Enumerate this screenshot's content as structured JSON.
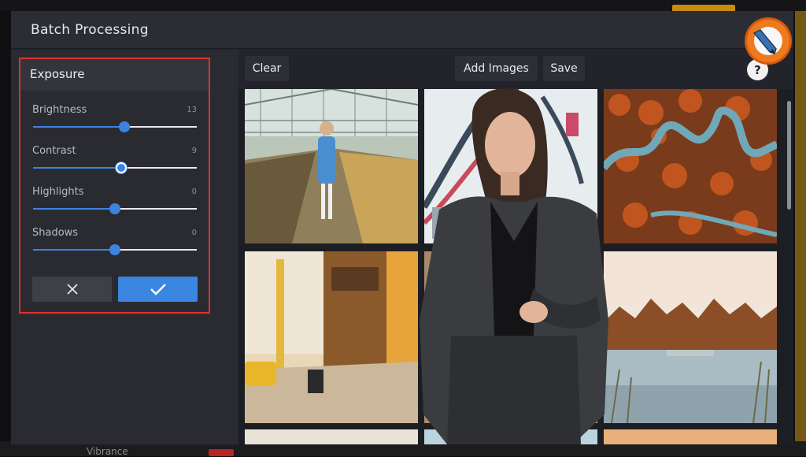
{
  "window": {
    "title": "Batch Processing"
  },
  "background": {
    "partial_label": "Vibrance"
  },
  "panel": {
    "title": "Exposure",
    "sliders": [
      {
        "label": "Brightness",
        "value": "13",
        "position": 0.56
      },
      {
        "label": "Contrast",
        "value": "9",
        "position": 0.54
      },
      {
        "label": "Highlights",
        "value": "0",
        "position": 0.5
      },
      {
        "label": "Shadows",
        "value": "0",
        "position": 0.5
      }
    ],
    "cancel_icon": "close-icon",
    "apply_icon": "checkmark-icon"
  },
  "toolbar": {
    "clear_label": "Clear",
    "add_images_label": "Add Images",
    "save_label": "Save",
    "help_label": "?"
  },
  "grid": {
    "images": [
      "greenhouse-woman-photo",
      "rollercoaster-photo",
      "winding-road-forest-photo",
      "city-street-taxi-photo",
      "hidden-photo",
      "lake-forest-photo"
    ]
  },
  "colors": {
    "accent": "#3c83e0",
    "highlight_border": "#e0312a",
    "modal_bg": "#24252c"
  }
}
